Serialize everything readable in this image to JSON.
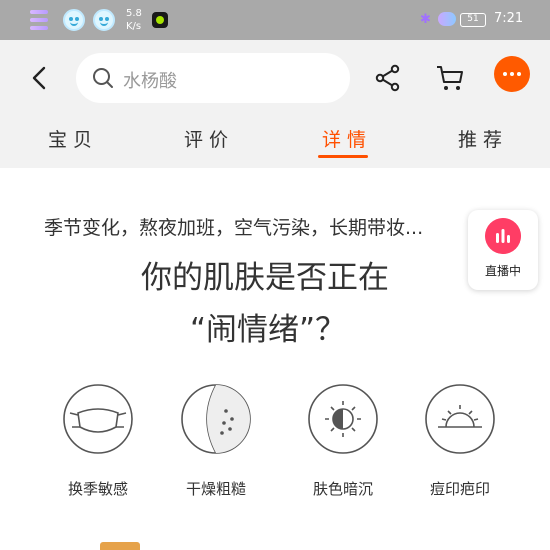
{
  "status_bar": {
    "speed_value": "5.8",
    "speed_unit": "K/s",
    "battery": "51",
    "time": "7:21"
  },
  "nav": {
    "search_text": "水杨酸"
  },
  "tabs": [
    {
      "label": "宝贝"
    },
    {
      "label": "评价"
    },
    {
      "label": "详情"
    },
    {
      "label": "推荐"
    }
  ],
  "content": {
    "intro": "季节变化，熬夜加班，空气污染，长期带妆...",
    "headline_line1": "你的肌肤是否正在",
    "headline_line2": "“闹情绪”？",
    "concerns": [
      {
        "label": "换季敏感",
        "icon": "mask-face-icon"
      },
      {
        "label": "干燥粗糙",
        "icon": "dry-skin-icon"
      },
      {
        "label": "肤色暗沉",
        "icon": "moon-dark-icon"
      },
      {
        "label": "痘印疤印",
        "icon": "sun-mark-icon"
      }
    ]
  },
  "live": {
    "label": "直播中"
  },
  "colors": {
    "accent": "#ff5000",
    "status_bar": "#a9a9a9",
    "nav_bg": "#f2f2f2"
  }
}
